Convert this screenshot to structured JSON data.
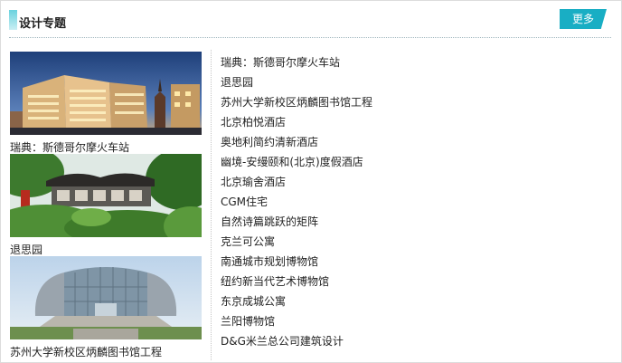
{
  "section": {
    "title": "设计专题",
    "more_label": "更多"
  },
  "featured": [
    {
      "caption": "瑞典：斯德哥尔摩火车站",
      "image": "stockholm-station-photo"
    },
    {
      "caption": "退思园",
      "image": "tuisi-garden-photo"
    },
    {
      "caption": "苏州大学新校区炳麟图书馆工程",
      "image": "library-building-photo"
    }
  ],
  "links": [
    "瑞典：斯德哥尔摩火车站",
    "退思园",
    "苏州大学新校区炳麟图书馆工程",
    "北京柏悦酒店",
    "奥地利简约清新酒店",
    "幽境-安缦颐和(北京)度假酒店",
    "北京瑜舍酒店",
    "CGM住宅",
    "自然诗篇跳跃的矩阵",
    "克兰可公寓",
    "南通城市规划博物馆",
    "纽约新当代艺术博物馆",
    "东京成城公寓",
    "兰阳博物馆",
    "D&G米兰总公司建筑设计"
  ],
  "colors": {
    "accent": "#19aec4"
  }
}
